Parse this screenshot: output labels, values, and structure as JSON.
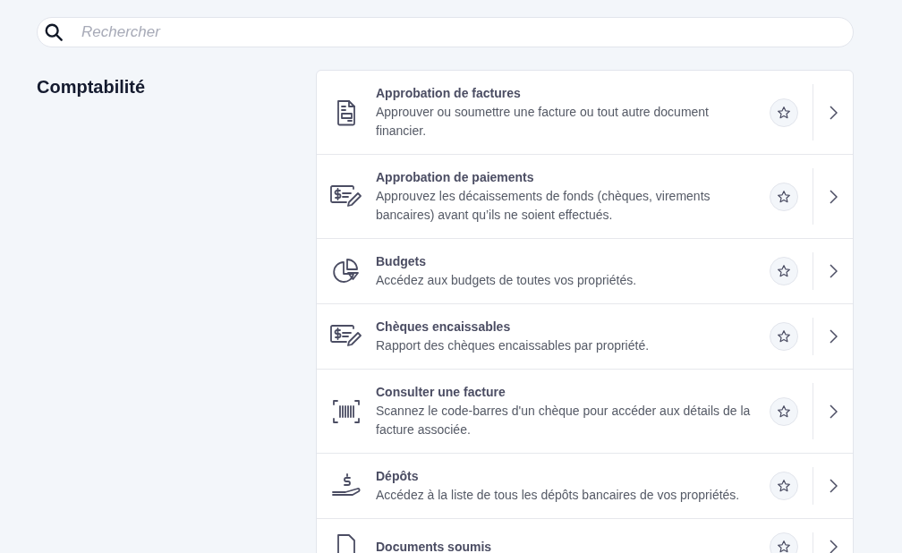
{
  "search": {
    "placeholder": "Rechercher"
  },
  "section": {
    "title": "Comptabilité"
  },
  "items": [
    {
      "kind": "invoice",
      "title": "Approbation de factures",
      "description": "Approuver ou soumettre une facture ou tout autre document financier.",
      "favorite": false
    },
    {
      "kind": "check",
      "title": "Approbation de paiements",
      "description": "Approuvez les décaissements de fonds (chèques, virements bancaires) avant qu’ils ne soient effectués.",
      "favorite": false
    },
    {
      "kind": "pie",
      "title": "Budgets",
      "description": "Accédez aux budgets de toutes vos propriétés.",
      "favorite": false
    },
    {
      "kind": "check",
      "title": "Chèques encaissables",
      "description": "Rapport des chèques encaissables par propriété.",
      "favorite": false
    },
    {
      "kind": "barcode",
      "title": "Consulter une facture",
      "description": "Scannez le code-barres d'un chèque pour accéder aux détails de la facture associée.",
      "favorite": false
    },
    {
      "kind": "deposit",
      "title": "Dépôts",
      "description": "Accédez à la liste de tous les dépôts bancaires de vos propriétés.",
      "favorite": false
    },
    {
      "kind": "document",
      "title": "Documents soumis",
      "favorite": false
    }
  ]
}
